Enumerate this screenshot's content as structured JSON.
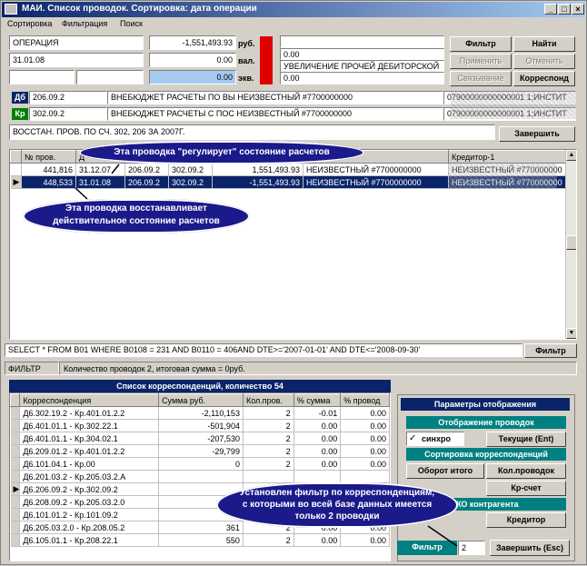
{
  "window": {
    "title": "МАИ. Список проводок. Сортировка: дата операции",
    "min": "_",
    "max": "□",
    "close": "×"
  },
  "menu": [
    "Сортировка",
    "Фильтрация",
    "Поиск"
  ],
  "header": {
    "operation_label": "ОПЕРАЦИЯ",
    "date": "31.01.08",
    "sum_rub": "-1,551,493.93",
    "rub_label": "руб.",
    "sum_val": "0.00",
    "val_label": "вал.",
    "sum_ekv": "0.00",
    "ekv_label": "экв.",
    "right_top": "0.00",
    "right_text": "УВЕЛИЧЕНИЕ ПРОЧЕЙ ДЕБИТОРСКОЙ",
    "right_bottom": "0.00"
  },
  "buttons": {
    "filter": "Фильтр",
    "find": "Найти",
    "apply": "Применить",
    "cancel": "Отменить",
    "link": "Связывание",
    "corresp": "Корреспонд",
    "finish": "Завершить",
    "filter2": "Фильтр"
  },
  "accounts": {
    "debit_tag": "Дб",
    "debit_acc": "206.09.2",
    "debit_name": "ВНЕБЮДЖЕТ РАСЧЕТЫ ПО ВЫ",
    "debit_unknown": "НЕИЗВЕСТНЫЙ #7700000000",
    "debit_code": "07900000000000001 1;ИНСТИТ",
    "credit_tag": "Кр",
    "credit_acc": "302.09.2",
    "credit_name": "ВНЕБЮДЖЕТ РАСЧЕТЫ С ПОС",
    "credit_unknown": "НЕИЗВЕСТНЫЙ #7700000000",
    "credit_code": "07900000000000001 1;ИНСТИТ"
  },
  "comment": "ВОССТАН. ПРОВ. ПО СЧ. 302, 206 ЗА 2007Г.",
  "entries": {
    "columns": [
      "№ пров.",
      "Д",
      "",
      "",
      "",
      "Кредитор-1"
    ],
    "rows": [
      {
        "no": "441,816",
        "date": "31.12.07",
        "deb": "206.09.2",
        "cred": "302.09.2",
        "sum": "1,551,493.93",
        "name": "НЕИЗВЕСТНЫЙ #7700000000",
        "cred1": "НЕИЗВЕСТНЫЙ #770000000"
      },
      {
        "no": "448,533",
        "date": "31.01.08",
        "deb": "206.09.2",
        "cred": "302.09.2",
        "sum": "-1,551,493.93",
        "name": "НЕИЗВЕСТНЫЙ #7700000000",
        "cred1": "НЕИЗВЕСТНЫЙ #770000000"
      }
    ]
  },
  "callouts": {
    "c1": "Эта проводка \"регулирует\" состояние расчетов",
    "c2_l1": "Эта проводка восстанавливает",
    "c2_l2": "действительное состояние расчетов",
    "c3_l1": "Установлен фильтр по корреспонденциям,",
    "c3_l2": "с которыми во всей базе данных имеется",
    "c3_l3": "только 2 проводки"
  },
  "sql": "SELECT * FROM B01 WHERE B0108 = 231 AND B0110 = 406AND DTE>='2007-01-01' AND DTE<='2008-09-30'",
  "status": {
    "left": "ФИЛЬТР",
    "right": "Количество проводок 2, итоговая сумма = 0руб."
  },
  "corr": {
    "title": "Список корреспонденций, количество 54",
    "columns": [
      "Корреспонденция",
      "Сумма руб.",
      "Кол.пров.",
      "% сумма",
      "% провод"
    ],
    "rows": [
      {
        "c": "Д6.302.19.2 - Кр.401.01.2.2",
        "s": "-2,110,153",
        "k": "2",
        "ps": "-0.01",
        "pp": "0.00"
      },
      {
        "c": "Д6.401.01.1 - Кр.302.22.1",
        "s": "-501,904",
        "k": "2",
        "ps": "0.00",
        "pp": "0.00"
      },
      {
        "c": "Д6.401.01.1 - Кр.304.02.1",
        "s": "-207,530",
        "k": "2",
        "ps": "0.00",
        "pp": "0.00"
      },
      {
        "c": "Д6.209.01.2 - Кр.401.01.2.2",
        "s": "-29,799",
        "k": "2",
        "ps": "0.00",
        "pp": "0.00"
      },
      {
        "c": "Д6.101.04.1 - Кр.00",
        "s": "0",
        "k": "2",
        "ps": "0.00",
        "pp": "0.00"
      },
      {
        "c": "Д6.201.03.2 - Кр.205.03.2.А",
        "s": "",
        "k": "",
        "ps": "",
        "pp": ""
      },
      {
        "c": "Д6.206.09.2 - Кр.302.09.2",
        "s": "",
        "k": "",
        "ps": "",
        "pp": ""
      },
      {
        "c": "Д6.208.09.2 - Кр.205.03.2.0",
        "s": "",
        "k": "",
        "ps": "",
        "pp": ""
      },
      {
        "c": "Д6.101.01.2 - Кр.101.09.2",
        "s": "",
        "k": "",
        "ps": "",
        "pp": ""
      },
      {
        "c": "Д6.205.03.2.0 - Кр.208.05.2",
        "s": "361",
        "k": "2",
        "ps": "0.00",
        "pp": "0.00"
      },
      {
        "c": "Д6.105.01.1 - Кр.208.22.1",
        "s": "550",
        "k": "2",
        "ps": "0.00",
        "pp": "0.00"
      }
    ]
  },
  "params": {
    "title": "Параметры отображения",
    "show_entries": "Отображение проводок",
    "sync": "синхро",
    "current": "Текущие (Ent)",
    "sort_corr": "Сортировка корреспонденций",
    "turnover": "Оборот итого",
    "count": "Кол.проводок",
    "kr_schet": "Кр-счет",
    "zho": "ЖО контрагента",
    "creditor": "Кредитор",
    "filter": "Фильтр",
    "filter_val": "2",
    "finish": "Завершить (Esc)"
  }
}
